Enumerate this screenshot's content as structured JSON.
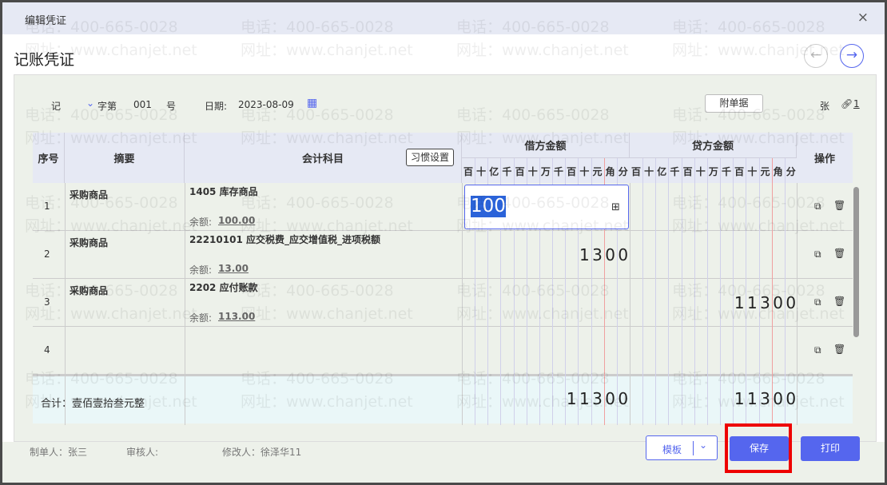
{
  "dialog": {
    "title": "编辑凭证",
    "close": "×"
  },
  "page_title": "记账凭证",
  "nav": {
    "prev": "←",
    "next": "→"
  },
  "voucher": {
    "type": "记",
    "type_suffix": "字第",
    "number": "001",
    "number_suffix": "号",
    "date_label": "日期:",
    "date": "2023-08-09",
    "attach_button": "附单据",
    "attach_unit": "张",
    "attach_count": "1"
  },
  "table": {
    "headers": {
      "seq": "序号",
      "summary": "摘要",
      "account": "会计科目",
      "habit_button": "习惯设置",
      "debit": "借方金额",
      "credit": "贷方金额",
      "ops": "操作"
    },
    "units": [
      "百",
      "十",
      "亿",
      "千",
      "百",
      "十",
      "万",
      "千",
      "百",
      "十",
      "元",
      "角",
      "分"
    ],
    "balance_label": "余额:",
    "rows": [
      {
        "seq": "1",
        "summary": "采购商品",
        "account": "1405 库存商品",
        "balance": "100.00",
        "debit_input": "100",
        "debit": "",
        "credit": ""
      },
      {
        "seq": "2",
        "summary": "采购商品",
        "account": "22210101 应交税费_应交增值税_进项税额",
        "balance": "13.00",
        "debit": "1300",
        "credit": ""
      },
      {
        "seq": "3",
        "summary": "采购商品",
        "account": "2202 应付账款",
        "balance": "113.00",
        "debit": "",
        "credit": "11300"
      },
      {
        "seq": "4",
        "summary": "",
        "account": "",
        "balance": "",
        "debit": "",
        "credit": ""
      }
    ],
    "total": {
      "label": "合计：壹佰壹拾叁元整",
      "debit": "11300",
      "credit": "11300"
    }
  },
  "footer": {
    "maker": "制单人：张三",
    "reviewer": "审核人:",
    "modifier": "修改人：徐泽华11",
    "template": "模板",
    "save": "保存",
    "print": "打印"
  },
  "watermark": {
    "phone": "电话：400-665-0028",
    "site": "网址：www.chanjet.net"
  },
  "colors": {
    "primary": "#5566ee",
    "highlight": "#ee0000"
  }
}
